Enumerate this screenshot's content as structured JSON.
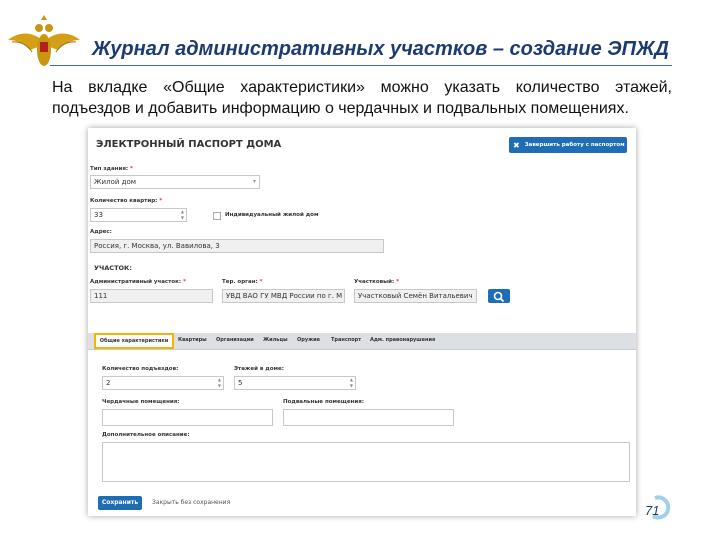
{
  "header": {
    "title": "Журнал административных участков – создание ЭПЖД"
  },
  "intro_text": "На вкладке «Общие характеристики» можно указать количество этажей, подъездов и добавить информацию о чердачных и подвальных помещениях.",
  "page_number": "71",
  "colors": {
    "accent": "#1f6db5",
    "title": "#1c3b70",
    "tab_highlight": "#f5b400"
  },
  "screen": {
    "page_title": "ЭЛЕКТРОННЫЙ ПАСПОРТ ДОМА",
    "finish_button": "Завершить работу с паспортом",
    "building_type": {
      "label": "Тип здания:",
      "value": "Жилой дом"
    },
    "apartments": {
      "label": "Количество квартир:",
      "value": "33"
    },
    "individual_house": {
      "label": "Индивидуальный жилой дом",
      "checked": false
    },
    "address": {
      "label": "Адрес:",
      "value": "Россия, г. Москва, ул. Вавилова, 3"
    },
    "district_section": "УЧАСТОК:",
    "admin_district": {
      "label": "Административный участок:",
      "value": "111"
    },
    "territorial_body": {
      "label": "Тер. орган:",
      "value": "УВД ВАО ГУ МВД России по г. М"
    },
    "officer": {
      "label": "Участковый:",
      "value": "Участковый Семён Витальевич"
    },
    "tabs": [
      "Общие характеристики",
      "Квартиры",
      "Организации",
      "Жильцы",
      "Оружие",
      "Транспорт",
      "Адм. правонарушения"
    ],
    "entrances": {
      "label": "Количество подъездов:",
      "value": "2"
    },
    "floors": {
      "label": "Этажей в доме:",
      "value": "5"
    },
    "attic": {
      "label": "Чердачные помещения:",
      "value": ""
    },
    "basement": {
      "label": "Подвальные помещения:",
      "value": ""
    },
    "extra": {
      "label": "Дополнительное описание:",
      "value": ""
    },
    "save_button": "Сохранить",
    "close_button": "Закрыть без сохранения"
  }
}
